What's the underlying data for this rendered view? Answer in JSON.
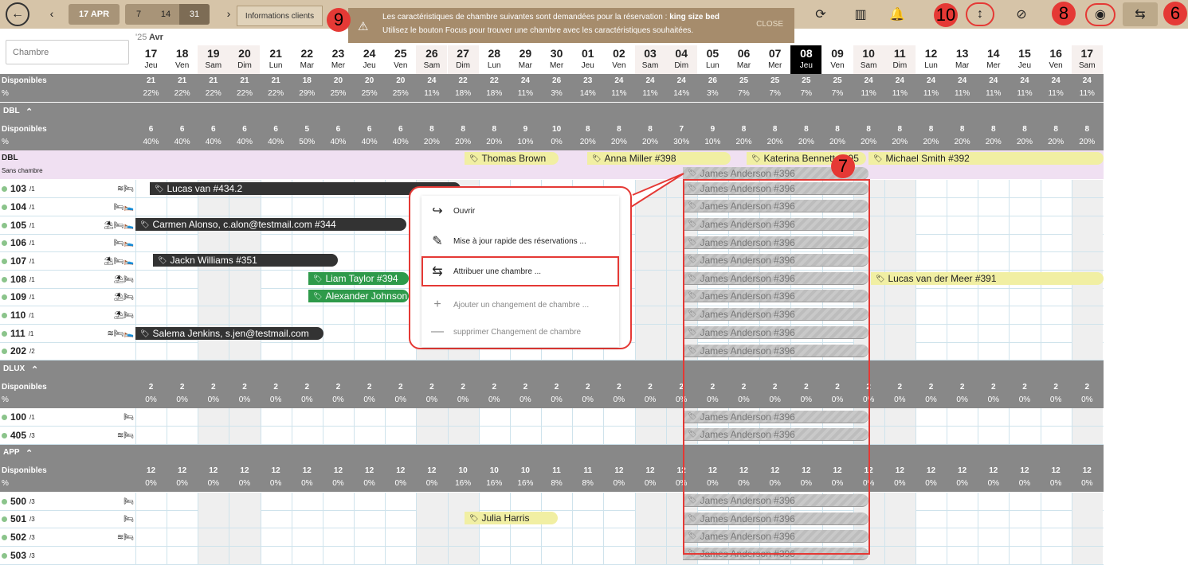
{
  "toolbar": {
    "back_icon": "arrow-left-icon",
    "date": "17 APR",
    "ranges": [
      "7",
      "14",
      "31"
    ],
    "active_range": "31",
    "info_button": "Informations clients",
    "icons": [
      "refresh-icon",
      "columns-icon",
      "bell-plus-icon",
      "vertical-resize-icon",
      "filter-off-icon",
      "focus-icon",
      "assign-room-icon"
    ]
  },
  "banner": {
    "line1_prefix": "Les caractéristiques de chambre suivantes sont demandées pour la réservation : ",
    "line1_bold": "king size bed",
    "line2": "Utilisez le bouton Focus pour trouver une chambre avec les caractéristiques souhaitées.",
    "close": "CLOSE"
  },
  "badges": {
    "b9": "9",
    "b10": "10",
    "b8": "8",
    "b6": "6",
    "b7": "7"
  },
  "search": {
    "placeholder": "Chambre"
  },
  "calendar": {
    "year": "'25",
    "month": "Avr",
    "days": [
      {
        "n": "17",
        "w": "Jeu"
      },
      {
        "n": "18",
        "w": "Ven"
      },
      {
        "n": "19",
        "w": "Sam"
      },
      {
        "n": "20",
        "w": "Dim"
      },
      {
        "n": "21",
        "w": "Lun"
      },
      {
        "n": "22",
        "w": "Mar"
      },
      {
        "n": "23",
        "w": "Mer"
      },
      {
        "n": "24",
        "w": "Jeu"
      },
      {
        "n": "25",
        "w": "Ven"
      },
      {
        "n": "26",
        "w": "Sam"
      },
      {
        "n": "27",
        "w": "Dim"
      },
      {
        "n": "28",
        "w": "Lun"
      },
      {
        "n": "29",
        "w": "Mar"
      },
      {
        "n": "30",
        "w": "Mer"
      },
      {
        "n": "01",
        "w": "Jeu"
      },
      {
        "n": "02",
        "w": "Ven"
      },
      {
        "n": "03",
        "w": "Sam"
      },
      {
        "n": "04",
        "w": "Dim"
      },
      {
        "n": "05",
        "w": "Lun"
      },
      {
        "n": "06",
        "w": "Mar"
      },
      {
        "n": "07",
        "w": "Mer"
      },
      {
        "n": "08",
        "w": "Jeu"
      },
      {
        "n": "09",
        "w": "Ven"
      },
      {
        "n": "10",
        "w": "Sam"
      },
      {
        "n": "11",
        "w": "Dim"
      },
      {
        "n": "12",
        "w": "Lun"
      },
      {
        "n": "13",
        "w": "Mar"
      },
      {
        "n": "14",
        "w": "Mer"
      },
      {
        "n": "15",
        "w": "Jeu"
      },
      {
        "n": "16",
        "w": "Ven"
      },
      {
        "n": "17",
        "w": "Sam"
      }
    ],
    "today_index": 21
  },
  "summary": {
    "label": "Disponibles",
    "pct": "%",
    "values": [
      "21",
      "21",
      "21",
      "21",
      "21",
      "18",
      "20",
      "20",
      "20",
      "24",
      "22",
      "22",
      "24",
      "26",
      "23",
      "24",
      "24",
      "24",
      "26",
      "25",
      "25",
      "25",
      "25",
      "24",
      "24",
      "24",
      "24",
      "24",
      "24",
      "24",
      "24"
    ],
    "pcts": [
      "22%",
      "22%",
      "22%",
      "22%",
      "22%",
      "29%",
      "25%",
      "25%",
      "25%",
      "11%",
      "18%",
      "18%",
      "11%",
      "3%",
      "14%",
      "11%",
      "11%",
      "14%",
      "3%",
      "7%",
      "7%",
      "7%",
      "7%",
      "11%",
      "11%",
      "11%",
      "11%",
      "11%",
      "11%",
      "11%",
      "11%"
    ]
  },
  "groups": [
    {
      "title": "DBL",
      "label": "Disponibles",
      "pct": "%",
      "values": [
        "6",
        "6",
        "6",
        "6",
        "6",
        "5",
        "6",
        "6",
        "6",
        "8",
        "8",
        "8",
        "9",
        "10",
        "8",
        "8",
        "8",
        "7",
        "9",
        "8",
        "8",
        "8",
        "8",
        "8",
        "8",
        "8",
        "8",
        "8",
        "8",
        "8",
        "8"
      ],
      "pcts": [
        "40%",
        "40%",
        "40%",
        "40%",
        "40%",
        "50%",
        "40%",
        "40%",
        "40%",
        "20%",
        "20%",
        "20%",
        "10%",
        "0%",
        "20%",
        "20%",
        "20%",
        "30%",
        "10%",
        "20%",
        "20%",
        "20%",
        "20%",
        "20%",
        "20%",
        "20%",
        "20%",
        "20%",
        "20%",
        "20%",
        "20%"
      ]
    },
    {
      "title": "DLUX",
      "label": "Disponibles",
      "pct": "%",
      "values": [
        "2",
        "2",
        "2",
        "2",
        "2",
        "2",
        "2",
        "2",
        "2",
        "2",
        "2",
        "2",
        "2",
        "2",
        "2",
        "2",
        "2",
        "2",
        "2",
        "2",
        "2",
        "2",
        "2",
        "2",
        "2",
        "2",
        "2",
        "2",
        "2",
        "2",
        "2"
      ],
      "pcts": [
        "0%",
        "0%",
        "0%",
        "0%",
        "0%",
        "0%",
        "0%",
        "0%",
        "0%",
        "0%",
        "0%",
        "0%",
        "0%",
        "0%",
        "0%",
        "0%",
        "0%",
        "0%",
        "0%",
        "0%",
        "0%",
        "0%",
        "0%",
        "0%",
        "0%",
        "0%",
        "0%",
        "0%",
        "0%",
        "0%",
        "0%"
      ]
    },
    {
      "title": "APP",
      "label": "Disponibles",
      "pct": "%",
      "values": [
        "12",
        "12",
        "12",
        "12",
        "12",
        "12",
        "12",
        "12",
        "12",
        "12",
        "10",
        "10",
        "10",
        "11",
        "11",
        "12",
        "12",
        "12",
        "12",
        "12",
        "12",
        "12",
        "12",
        "12",
        "12",
        "12",
        "12",
        "12",
        "12",
        "12",
        "12"
      ],
      "pcts": [
        "0%",
        "0%",
        "0%",
        "0%",
        "0%",
        "0%",
        "0%",
        "0%",
        "0%",
        "0%",
        "16%",
        "16%",
        "16%",
        "8%",
        "8%",
        "0%",
        "0%",
        "0%",
        "0%",
        "0%",
        "0%",
        "0%",
        "0%",
        "0%",
        "0%",
        "0%",
        "0%",
        "0%",
        "0%",
        "0%",
        "0%"
      ]
    }
  ],
  "unassigned": {
    "title": "DBL",
    "subtitle": "Sans chambre"
  },
  "rooms": [
    {
      "num": "103",
      "sub": "/1",
      "icons": "≋🛏"
    },
    {
      "num": "104",
      "sub": "/1",
      "icons": "🛏🛌"
    },
    {
      "num": "105",
      "sub": "/1",
      "icons": "⛱🛏🛌"
    },
    {
      "num": "106",
      "sub": "/1",
      "icons": "🛏🛌"
    },
    {
      "num": "107",
      "sub": "/1",
      "icons": "⛱🛏🛌"
    },
    {
      "num": "108",
      "sub": "/1",
      "icons": "⛱🛏"
    },
    {
      "num": "109",
      "sub": "/1",
      "icons": "⛱🛏"
    },
    {
      "num": "110",
      "sub": "/1",
      "icons": "⛱🛏"
    },
    {
      "num": "111",
      "sub": "/1",
      "icons": "≋🛏🛌"
    },
    {
      "num": "202",
      "sub": "/2",
      "icons": ""
    },
    {
      "num": "100",
      "sub": "/1",
      "icons": "🛏"
    },
    {
      "num": "405",
      "sub": "/3",
      "icons": "≋🛏"
    },
    {
      "num": "500",
      "sub": "/3",
      "icons": "🛏"
    },
    {
      "num": "501",
      "sub": "/3",
      "icons": "🛏"
    },
    {
      "num": "502",
      "sub": "/3",
      "icons": "≋🛏"
    },
    {
      "num": "503",
      "sub": "/3",
      "icons": ""
    }
  ],
  "bookings": {
    "thomas": "Thomas Brown",
    "anna": "Anna Miller #398",
    "katerina": "Katerina Bennett #395",
    "michael": "Michael Smith #392",
    "james": "James Anderson #396",
    "lucas1": "Lucas van #434.2",
    "carmen": "Carmen Alonso, c.alon@testmail.com #344",
    "jackn": "Jackn Williams #351",
    "liam": "Liam Taylor #394",
    "alexander": "Alexander Johnson",
    "salema": "Salema Jenkins, s.jen@testmail.com",
    "lucas2": "Lucas van der Meer #391",
    "julia": "Julia Harris"
  },
  "menu": [
    {
      "label": "Ouvrir",
      "icon": "share-arrow-icon",
      "disabled": false
    },
    {
      "label": "Mise à jour rapide des réservations ...",
      "icon": "pencil-icon",
      "disabled": false
    },
    {
      "label": "Attribuer une chambre ...",
      "icon": "assign-room-icon",
      "disabled": false
    },
    {
      "label": "Ajouter un changement de chambre ...",
      "icon": "plus-icon",
      "disabled": true
    },
    {
      "label": "supprimer Changement de chambre",
      "icon": "minus-icon",
      "disabled": true
    }
  ]
}
